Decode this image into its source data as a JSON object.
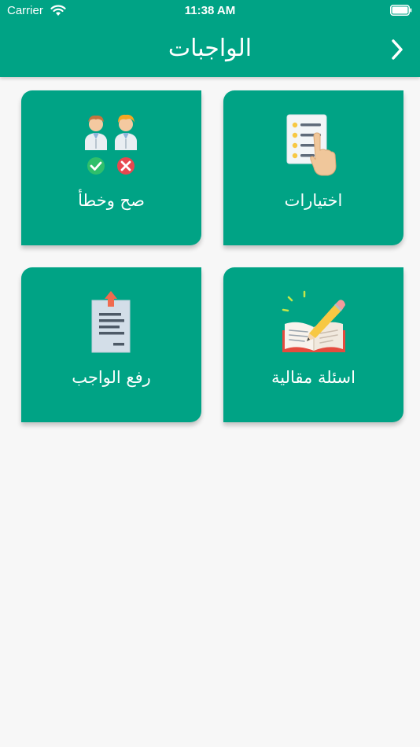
{
  "status_bar": {
    "carrier": "Carrier",
    "time": "11:38 AM"
  },
  "nav": {
    "title": "الواجبات",
    "back_icon": "chevron-right-icon"
  },
  "colors": {
    "primary": "#00a385",
    "background": "#f7f7f7"
  },
  "cards": [
    {
      "label": "اختيارات",
      "icon": "multiple-choice-icon"
    },
    {
      "label": "صح وخطأ",
      "icon": "true-false-icon"
    },
    {
      "label": "اسئلة مقالية",
      "icon": "essay-questions-icon"
    },
    {
      "label": "رفع الواجب",
      "icon": "upload-homework-icon"
    }
  ]
}
